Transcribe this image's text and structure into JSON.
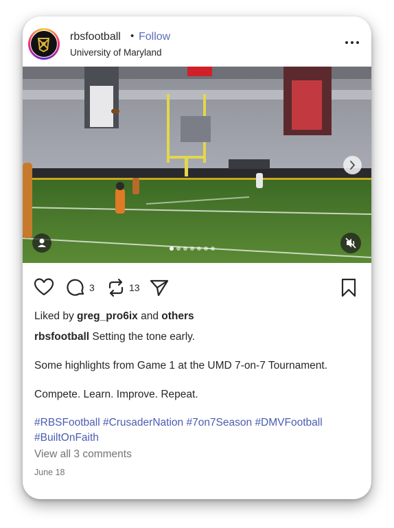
{
  "post": {
    "username": "rbsfootball",
    "separator": "•",
    "follow_label": "Follow",
    "location": "University of Maryland",
    "more_icon": "more-horizontal-icon"
  },
  "media": {
    "slide_count": 7,
    "active_slide": 1,
    "next_icon": "chevron-right-icon",
    "tag_icon": "person-icon",
    "mute_icon": "speaker-muted-icon"
  },
  "actions": {
    "like_icon": "heart-icon",
    "comment_icon": "comment-icon",
    "comment_count": "3",
    "repost_icon": "repost-icon",
    "repost_count": "13",
    "share_icon": "send-icon",
    "save_icon": "bookmark-icon"
  },
  "likes": {
    "prefix": "Liked by",
    "user": "greg_pro6ix",
    "and": "and",
    "others": "others"
  },
  "caption": {
    "username": "rbsfootball",
    "line1": "Setting the tone early.",
    "line2": "Some highlights from Game 1 at the UMD 7-on-7 Tournament.",
    "line3": "Compete. Learn. Improve. Repeat.",
    "hashtags": [
      "#RBSFootball",
      "#CrusaderNation",
      "#7on7Season",
      "#DMVFootball",
      "#BuiltOnFaith"
    ]
  },
  "comments": {
    "view_all": "View all 3 comments"
  },
  "date": "June 18",
  "colors": {
    "link": "#5b6fb5",
    "hashtag": "#4a5cb0",
    "muted": "#737373",
    "turf": "#4e7a2e"
  }
}
